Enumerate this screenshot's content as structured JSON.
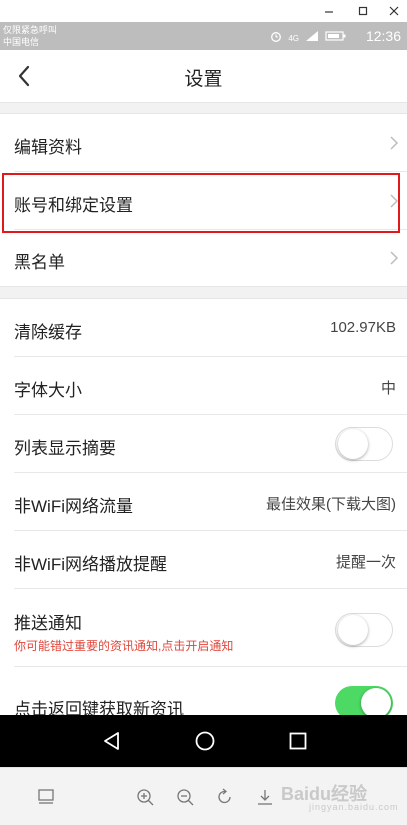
{
  "window": {
    "minimize_icon": "minimize-icon",
    "maximize_icon": "maximize-icon",
    "close_icon": "close-icon"
  },
  "status_bar": {
    "line1": "仅限紧急呼叫",
    "line2": "中国电信",
    "time": "12:36",
    "network_label": "4G",
    "icons": [
      "alarm-icon",
      "signal-icon",
      "battery-icon"
    ]
  },
  "header": {
    "title": "设置",
    "back_icon": "back-chevron-icon"
  },
  "group1": [
    {
      "label": "编辑资料"
    },
    {
      "label": "账号和绑定设置"
    },
    {
      "label": "黑名单"
    }
  ],
  "group2": {
    "clear_cache": {
      "label": "清除缓存",
      "value": "102.97KB"
    },
    "font_size": {
      "label": "字体大小",
      "value": "中"
    },
    "list_summary": {
      "label": "列表显示摘要",
      "toggle": "off"
    },
    "non_wifi_traffic": {
      "label": "非WiFi网络流量",
      "value": "最佳效果(下载大图)"
    },
    "non_wifi_play": {
      "label": "非WiFi网络播放提醒",
      "value": "提醒一次"
    },
    "push": {
      "label": "推送通知",
      "hint": "你可能错过重要的资讯通知,点击开启通知",
      "toggle": "off"
    },
    "back_refresh": {
      "label": "点击返回键获取新资讯",
      "toggle": "on"
    }
  },
  "colors": {
    "toggle_on": "#4cd964",
    "hint": "#e0463b",
    "highlight": "#e0191b"
  },
  "nav_bar": {
    "icons": [
      "back-triangle-icon",
      "home-circle-icon",
      "recents-square-icon"
    ]
  },
  "toolbar": {
    "icons": [
      "gallery-icon",
      "zoom-in-icon",
      "zoom-out-icon",
      "rotate-icon",
      "download-icon"
    ],
    "watermark": "Baidu经验",
    "watermark_sub": "jingyan.baidu.com"
  }
}
